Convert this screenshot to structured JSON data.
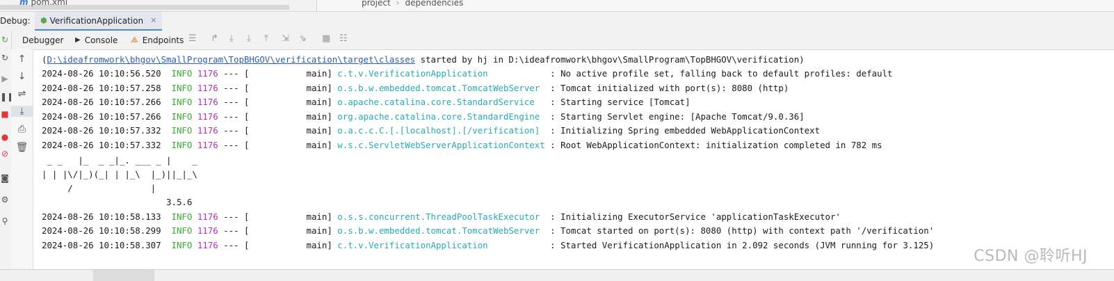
{
  "project_pane": {
    "file_icon": "m",
    "file_name": "pom.xml"
  },
  "breadcrumb": {
    "items": [
      "project",
      "dependencies"
    ],
    "separator": "›"
  },
  "debug": {
    "label": "Debug:",
    "run_tab": "VerificationApplication"
  },
  "toolbar": {
    "debugger_label": "Debugger",
    "console_label": "Console",
    "endpoints_label": "Endpoints"
  },
  "console": {
    "path_prefix": "(",
    "path_link": "D:\\ideafromwork\\bhgov\\SmallProgram\\TopBHGOV\\verification\\target\\classes",
    "path_suffix": " started by hj in D:\\ideafromwork\\bhgov\\SmallProgram\\TopBHGOV\\verification)",
    "logs": [
      {
        "ts": "2024-08-26 10:10:56.520",
        "level": "INFO",
        "pid": "1176",
        "sep": "--- [",
        "thread": "main]",
        "logger": "c.t.v.VerificationApplication",
        "msg": ": No active profile set, falling back to default profiles: default"
      },
      {
        "ts": "2024-08-26 10:10:57.258",
        "level": "INFO",
        "pid": "1176",
        "sep": "--- [",
        "thread": "main]",
        "logger": "o.s.b.w.embedded.tomcat.TomcatWebServer",
        "msg": ": Tomcat initialized with port(s): 8080 (http)"
      },
      {
        "ts": "2024-08-26 10:10:57.266",
        "level": "INFO",
        "pid": "1176",
        "sep": "--- [",
        "thread": "main]",
        "logger": "o.apache.catalina.core.StandardService",
        "msg": ": Starting service [Tomcat]"
      },
      {
        "ts": "2024-08-26 10:10:57.266",
        "level": "INFO",
        "pid": "1176",
        "sep": "--- [",
        "thread": "main]",
        "logger": "org.apache.catalina.core.StandardEngine",
        "msg": ": Starting Servlet engine: [Apache Tomcat/9.0.36]"
      },
      {
        "ts": "2024-08-26 10:10:57.332",
        "level": "INFO",
        "pid": "1176",
        "sep": "--- [",
        "thread": "main]",
        "logger": "o.a.c.c.C.[.[localhost].[/verification]",
        "msg": ": Initializing Spring embedded WebApplicationContext"
      },
      {
        "ts": "2024-08-26 10:10:57.332",
        "level": "INFO",
        "pid": "1176",
        "sep": "--- [",
        "thread": "main]",
        "logger": "w.s.c.ServletWebServerApplicationContext",
        "msg": ": Root WebApplicationContext: initialization completed in 782 ms"
      }
    ],
    "banner": [
      " _ _   |_  _ _|_. ___ _ |    _",
      "| | |\\/|_)(_| | |_\\  |_)||_|_\\",
      "     /               |",
      "                        3.5.6"
    ],
    "logs2": [
      {
        "ts": "2024-08-26 10:10:58.133",
        "level": "INFO",
        "pid": "1176",
        "sep": "--- [",
        "thread": "main]",
        "logger": "o.s.s.concurrent.ThreadPoolTaskExecutor",
        "msg": ": Initializing ExecutorService 'applicationTaskExecutor'"
      },
      {
        "ts": "2024-08-26 10:10:58.299",
        "level": "INFO",
        "pid": "1176",
        "sep": "--- [",
        "thread": "main]",
        "logger": "o.s.b.w.embedded.tomcat.TomcatWebServer",
        "msg": ": Tomcat started on port(s): 8080 (http) with context path '/verification'"
      },
      {
        "ts": "2024-08-26 10:10:58.307",
        "level": "INFO",
        "pid": "1176",
        "sep": "--- [",
        "thread": "main]",
        "logger": "c.t.v.VerificationApplication",
        "msg": ": Started VerificationApplication in 2.092 seconds (JVM running for 3.125)"
      }
    ]
  },
  "watermark": "CSDN @聆听HJ",
  "colors": {
    "info": "#3aab2e",
    "pid": "#b42eb4",
    "logger": "#27aab5",
    "link": "#2a5db0"
  }
}
